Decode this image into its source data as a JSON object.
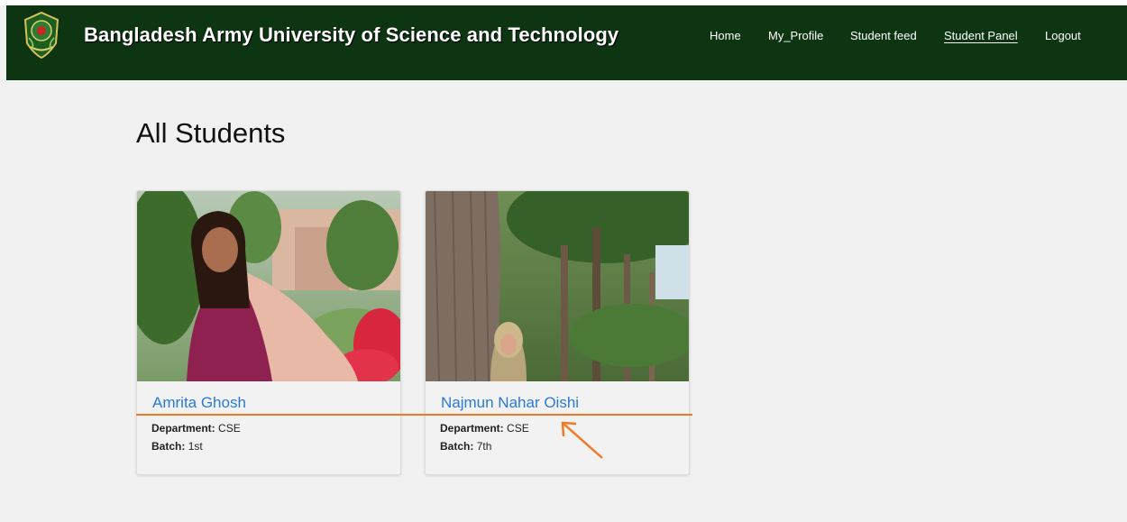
{
  "brand": {
    "title": "Bangladesh Army University of Science and Technology"
  },
  "nav": [
    {
      "label": "Home"
    },
    {
      "label": "My_Profile"
    },
    {
      "label": "Student feed"
    },
    {
      "label": "Student Panel",
      "active": true
    },
    {
      "label": "Logout"
    }
  ],
  "page": {
    "title": "All Students"
  },
  "students": [
    {
      "name": "Amrita Ghosh",
      "department_label": "Department:",
      "department": "CSE",
      "batch_label": "Batch:",
      "batch": "1st"
    },
    {
      "name": "Najmun Nahar Oishi",
      "department_label": "Department:",
      "department": "CSE",
      "batch_label": "Batch:",
      "batch": "7th"
    }
  ],
  "colors": {
    "navbar": "#0d3512",
    "link": "#2a7ad4",
    "annotation": "#f07b24",
    "background": "#f1f1f1"
  }
}
